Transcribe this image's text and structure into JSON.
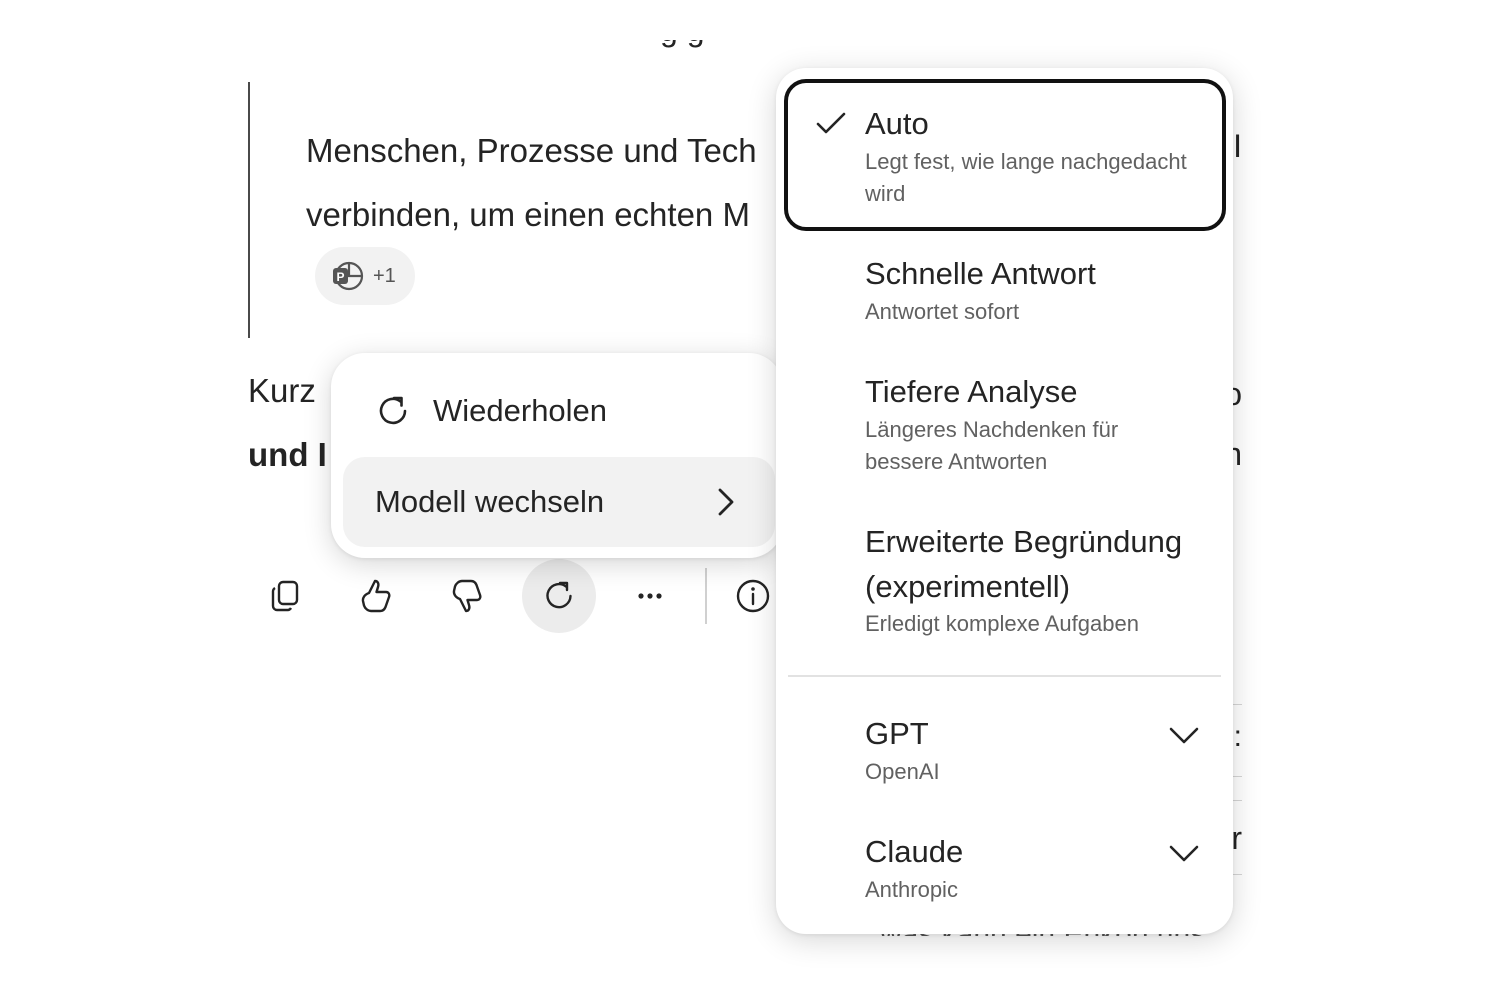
{
  "chat": {
    "top_cut_text": "g  g",
    "quote_line_1": "Menschen, Prozesse und Tech",
    "quote_line_2": "verbinden, um einen echten M",
    "citation_count": "+1",
    "body_line_1": "Kurz",
    "body_line_2": "und I",
    "right_edge_1": "KI",
    "right_edge_2": "o",
    "right_edge_3": "n",
    "right_edge_4": "s:",
    "right_edge_5": "r",
    "bottom_cut_text": "was kann ein  Enkon uns"
  },
  "toolbar": {
    "copy_icon": "copy-icon",
    "like_icon": "thumbs-up-icon",
    "dislike_icon": "thumbs-down-icon",
    "retry_icon": "refresh-icon",
    "more_icon": "more-icon",
    "info_icon": "info-icon"
  },
  "context_menu": {
    "retry_label": "Wiederholen",
    "switch_model_label": "Modell wechseln"
  },
  "model_menu": {
    "selected": "Auto",
    "options": [
      {
        "title": "Auto",
        "desc_1": "Legt fest, wie lange nachgedacht",
        "desc_2": "wird"
      },
      {
        "title": "Schnelle Antwort",
        "desc_1": "Antwortet sofort"
      },
      {
        "title": "Tiefere Analyse",
        "desc_1": "Längeres Nachdenken für",
        "desc_2": "bessere Antworten"
      },
      {
        "title_1": "Erweiterte Begründung",
        "title_2": "(experimentell)",
        "desc_1": "Erledigt komplexe Aufgaben"
      }
    ],
    "providers": [
      {
        "title": "GPT",
        "desc": "OpenAI"
      },
      {
        "title": "Claude",
        "desc": "Anthropic"
      }
    ]
  },
  "colors": {
    "text": "#242424",
    "secondary_text": "#616161",
    "selected_border": "#111111",
    "hover_bg": "#f2f2f2"
  }
}
